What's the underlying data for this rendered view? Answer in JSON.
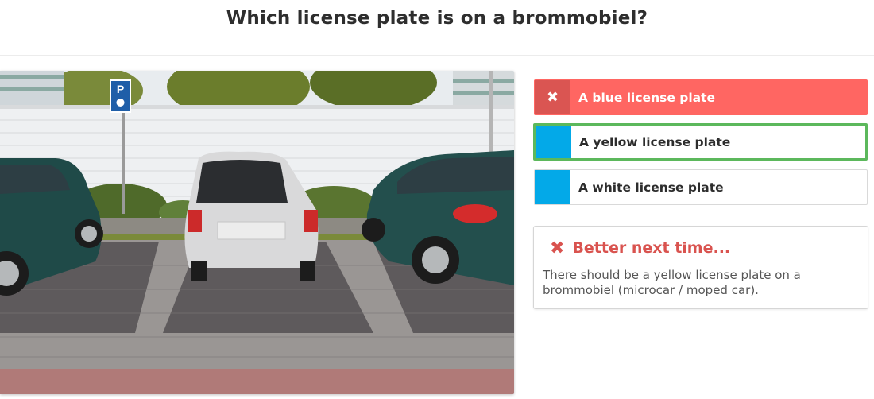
{
  "question": {
    "title": "Which license plate is on a brommobiel?"
  },
  "image": {
    "description_icon": "parking-sign-icon",
    "parking_sign_letter": "P"
  },
  "answers": [
    {
      "label": "A blue license plate",
      "state": "wrong",
      "icon": "cross-icon",
      "icon_glyph": "✖"
    },
    {
      "label": "A yellow license plate",
      "state": "correct"
    },
    {
      "label": "A white license plate",
      "state": "neutral"
    }
  ],
  "feedback": {
    "icon": "cross-icon",
    "icon_glyph": "✖",
    "title": "Better next time...",
    "text": "There should be a yellow license plate on a brommobiel (microcar / moped car)."
  },
  "colors": {
    "wrong_bg": "#ff6662",
    "wrong_lead": "#da5552",
    "correct_border": "#5cb85c",
    "lead_blue": "#03a9e8",
    "feedback_red": "#d9534f"
  }
}
